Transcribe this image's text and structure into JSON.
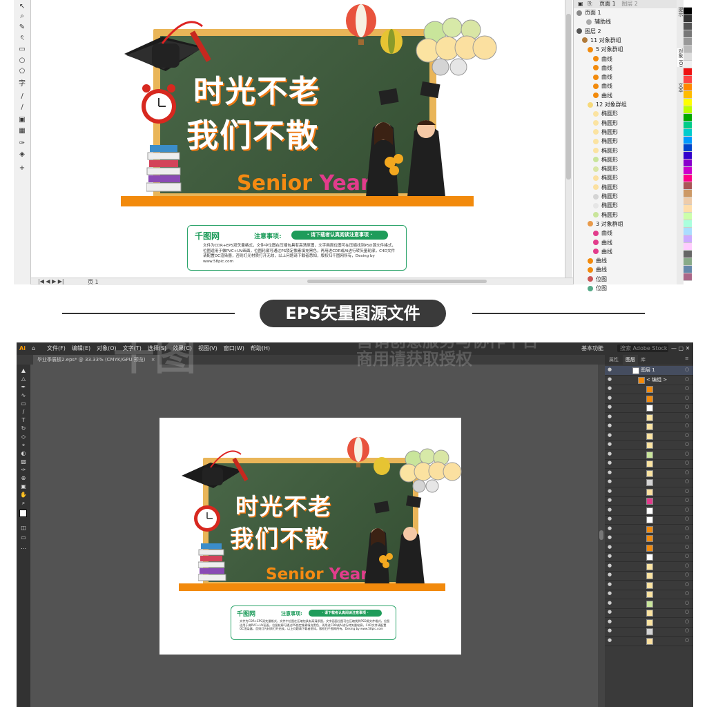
{
  "top_app": {
    "layers": {
      "page_label": "页面 1",
      "guides_label": "辅助线",
      "layer_label": "图层 2",
      "group11": "11 对象群组",
      "group5": "5 对象群组",
      "curve": "曲线",
      "group12": "12 对象群组",
      "ellipse": "椭圆形",
      "group3": "3 对象群组",
      "bitmap": "位图",
      "header_tab1": "页面 1",
      "header_tab2": "图层 2",
      "ellipse_count": 12
    },
    "side_tabs": [
      "提示",
      "对象 (O)",
      "文本"
    ],
    "page_tab": "页 1"
  },
  "artwork": {
    "title_line1": "时光不老",
    "title_line2": "我们不散",
    "senior_a": "Senior",
    "senior_b": "Year",
    "notice_logo": "千图网",
    "notice_label": "注意事项:",
    "notice_pill": "· 请下载者认真阅读注意事项 ·",
    "notice_body": "文件为CDR+EPS双矢量格式，文件中位图在压缩包具有高清原图，文字画面位图可在压缩找到PSD源文件格式，位图适用于做PVC+UV画面，位图轮廓可通过PS锁定像素填充黑色，再用进CDR或AI进行转矢量轮廓，C4D文件请配置OC渲染器，否则灯光材质打开无效，以上问题请下载者悉知，版权归千图网所有，Desing by www.58pic.com"
  },
  "divider": {
    "label": "EPS矢量图源文件"
  },
  "ai_app": {
    "logo": "Ai",
    "menu": [
      "文件(F)",
      "编辑(E)",
      "对象(O)",
      "文字(T)",
      "选择(S)",
      "效果(C)",
      "视图(V)",
      "窗口(W)",
      "帮助(H)"
    ],
    "workspace": "基本功能",
    "search_placeholder": "搜索 Adobe Stock",
    "doc_tab": "毕业季展板2.eps* @ 33.33% (CMYK/GPU 预览)",
    "panel_tabs": [
      "属性",
      "图层",
      "库"
    ],
    "layer_name": "图层 1",
    "group_name": "< 编组 >",
    "layer_rows": 30
  },
  "watermark": {
    "brand": "千图",
    "slogan1": "营销创意服务与协作平台",
    "slogan2": "商用请获取授权"
  },
  "colors": {
    "board": "#3e5d3c",
    "frame": "#e9b558",
    "shelf": "#f28a0c",
    "notice_green": "#1f9c5a",
    "year_pink": "#e23c8c"
  }
}
